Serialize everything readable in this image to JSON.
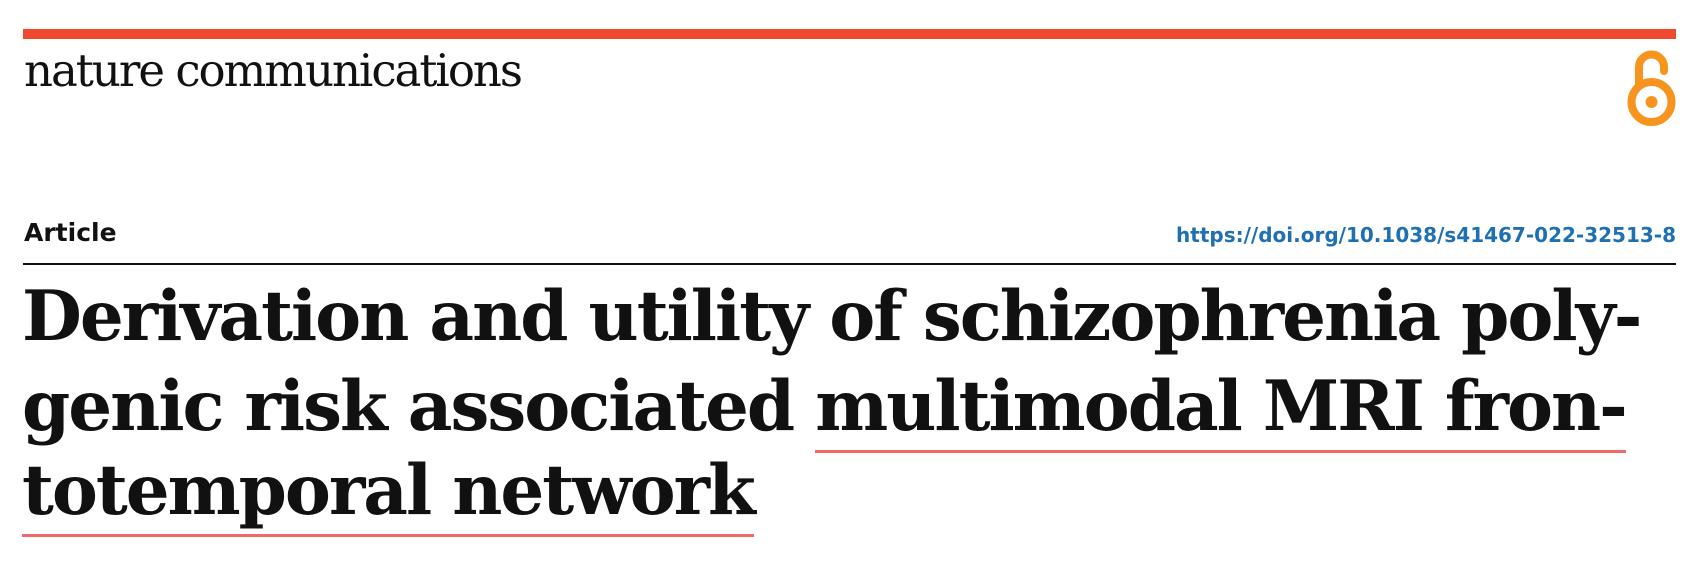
{
  "header": {
    "journal_name": "nature communications",
    "article_type": "Article",
    "doi": "https://doi.org/10.1038/s41467-022-32513-8",
    "open_access_icon": "open-access-lock-icon"
  },
  "title": {
    "line1": "Derivation and utility of schizophrenia poly-",
    "line2_plain": "genic risk associated ",
    "line2_highlighted": "multimodal MRI fron-",
    "line3_highlighted": "totemporal network"
  },
  "colors": {
    "brand_bar": "#ef4a2f",
    "doi_link": "#1f6fb3",
    "open_access_icon": "#f7941d",
    "highlight_underline": "#f06a6a"
  }
}
